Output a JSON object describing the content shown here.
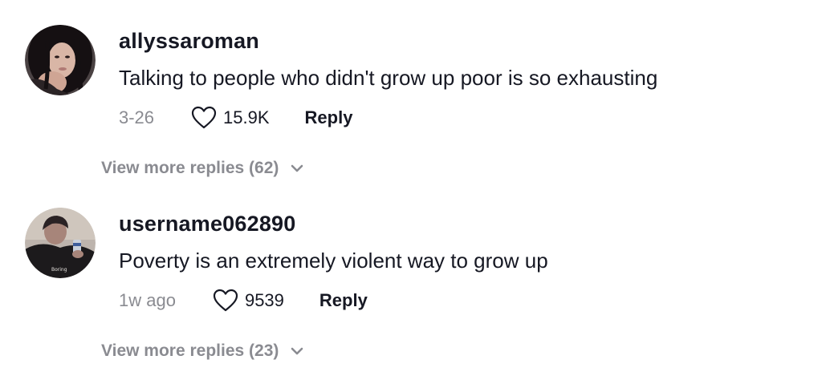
{
  "comments": [
    {
      "username": "allyssaroman",
      "text": "Talking to people who didn't grow up poor is so exhausting",
      "date": "3-26",
      "likes": "15.9K",
      "reply_label": "Reply",
      "more_replies": "View more replies (62)"
    },
    {
      "username": "username062890",
      "text": "Poverty is an extremely violent way to grow up",
      "date": "1w ago",
      "likes": "9539",
      "reply_label": "Reply",
      "more_replies": "View more replies (23)",
      "avatar_caption": "Boring"
    }
  ],
  "colors": {
    "text": "#161823",
    "muted": "#8a8b91",
    "background": "#ffffff"
  },
  "icons": {
    "like": "heart-outline-icon",
    "expand": "chevron-down-icon"
  }
}
